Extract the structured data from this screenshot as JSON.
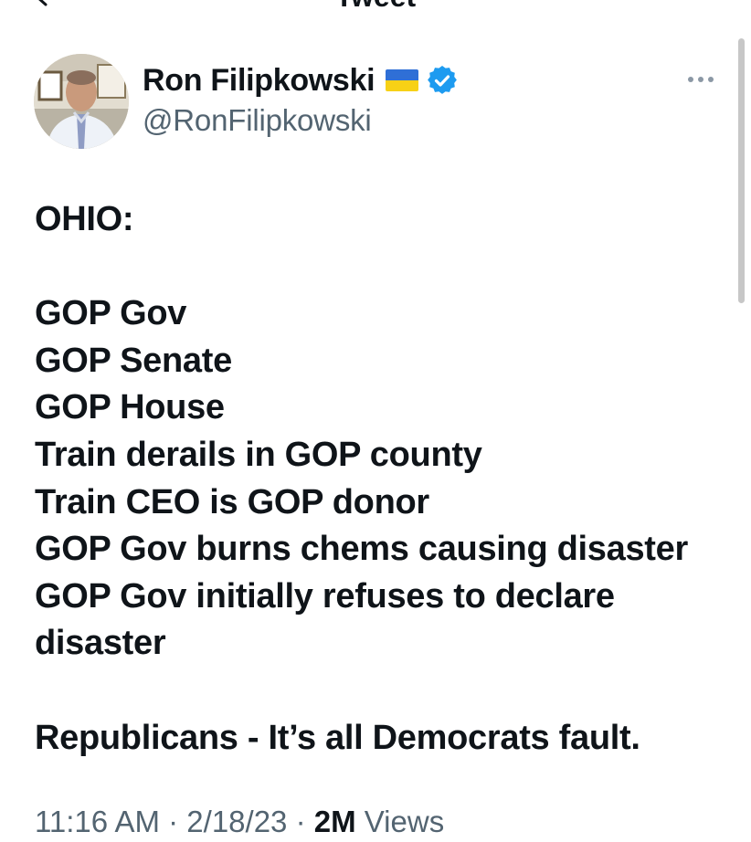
{
  "header": {
    "title": "Tweet"
  },
  "author": {
    "display_name": "Ron Filipkowski",
    "handle": "@RonFilipkowski",
    "flag_icon": "ukraine-flag-icon",
    "verified_icon": "verified-badge-icon",
    "verified_color": "#1d9bf0"
  },
  "tweet": {
    "lines": [
      "OHIO:",
      "",
      "GOP Gov",
      "GOP Senate",
      "GOP House",
      "Train derails in GOP county",
      "Train CEO is GOP donor",
      "GOP Gov burns chems causing disaster",
      "GOP Gov initially refuses to declare",
      "disaster",
      "",
      "Republicans - It’s all Democrats fault."
    ]
  },
  "meta": {
    "time": "11:16 AM · 2/18/23 ·",
    "views_count": "2M",
    "views_label": "Views"
  },
  "colors": {
    "text": "#0f1419",
    "secondary": "#536471",
    "flag_blue": "#2f6fd6",
    "flag_yellow": "#f7d116"
  }
}
